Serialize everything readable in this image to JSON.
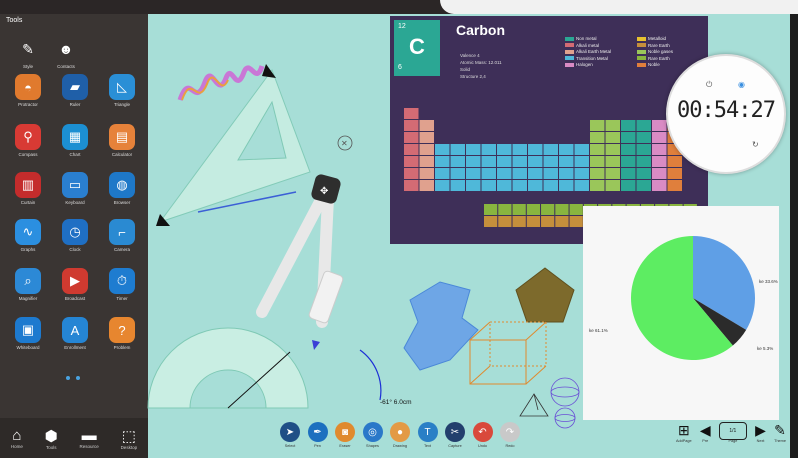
{
  "sidebar": {
    "title": "Tools",
    "top_items": [
      {
        "label": "Style",
        "icon": "paint-icon"
      },
      {
        "label": "Contacts",
        "icon": "contacts-icon"
      }
    ],
    "tools": [
      {
        "label": "Protractor",
        "icon": "protractor-icon",
        "color": "#e07a2e"
      },
      {
        "label": "Ruler",
        "icon": "ruler-icon",
        "color": "#1f5fa8"
      },
      {
        "label": "Triangle",
        "icon": "triangle-icon",
        "color": "#2a8fd6"
      },
      {
        "label": "Compass",
        "icon": "compass-icon",
        "color": "#d83a34"
      },
      {
        "label": "Chart",
        "icon": "chart-icon",
        "color": "#1c8fd2"
      },
      {
        "label": "Calculator",
        "icon": "calculator-icon",
        "color": "#e6823a"
      },
      {
        "label": "Curtain",
        "icon": "curtain-icon",
        "color": "#c42c2c"
      },
      {
        "label": "Keyboard",
        "icon": "keyboard-icon",
        "color": "#2a7fd0"
      },
      {
        "label": "Browser",
        "icon": "browser-icon",
        "color": "#1e78c8"
      },
      {
        "label": "Graphs",
        "icon": "graphs-icon",
        "color": "#2b8fe0"
      },
      {
        "label": "Clock",
        "icon": "clock-icon",
        "color": "#1f6fc4"
      },
      {
        "label": "Camera",
        "icon": "camera-icon",
        "color": "#2a8ad2"
      },
      {
        "label": "Magnifier",
        "icon": "magnifier-icon",
        "color": "#2c89d6"
      },
      {
        "label": "Broadcast",
        "icon": "broadcast-icon",
        "color": "#cf3a30"
      },
      {
        "label": "Timer",
        "icon": "timer-icon",
        "color": "#1e7cd0"
      },
      {
        "label": "Whiteboard",
        "icon": "monitor-icon",
        "color": "#1d7acf"
      },
      {
        "label": "Enrollment",
        "icon": "grade-icon",
        "color": "#2585d4"
      },
      {
        "label": "Problem",
        "icon": "question-icon",
        "color": "#e7862f"
      }
    ],
    "bottom": [
      {
        "label": "Home",
        "glyph": "⌂",
        "icon": "home-icon"
      },
      {
        "label": "Tools",
        "glyph": "⬢",
        "icon": "tools-icon"
      },
      {
        "label": "Resource",
        "glyph": "▬",
        "icon": "folder-icon"
      },
      {
        "label": "Desktop",
        "glyph": "⬚",
        "icon": "desktop-icon"
      }
    ]
  },
  "periodic_table": {
    "atomic_number": "12",
    "symbol": "C",
    "mass_number": "6",
    "name": "Carbon",
    "info_lines": [
      "Valence 4",
      "Atomic Mass: 12.011",
      "Solid",
      "Structure 2,4"
    ],
    "legend": [
      {
        "label": "Non metal",
        "color": "#2ba794"
      },
      {
        "label": "Alkali metal",
        "color": "#d36b74"
      },
      {
        "label": "Alkali Earth Metal",
        "color": "#e0a18e"
      },
      {
        "label": "Transition Metal",
        "color": "#4fb8d9"
      },
      {
        "label": "Halogen",
        "color": "#d98bc4"
      },
      {
        "label": "Metalloid",
        "color": "#e6c12f"
      },
      {
        "label": "Rare Earth",
        "color": "#c58f3c"
      },
      {
        "label": "Noble gases",
        "color": "#9ac65a"
      },
      {
        "label": "Rare Earth",
        "color": "#89b53f"
      },
      {
        "label": "Noble",
        "color": "#e07f3c"
      }
    ]
  },
  "clock": {
    "time": "00:54:27"
  },
  "measurement": "-61° 6.0cm",
  "pie": {
    "slices": [
      {
        "label": "ke 33.6%",
        "value": 33.6,
        "color": "#5f9fe6"
      },
      {
        "label": "ke 5.3%",
        "value": 5.3,
        "color": "#2b2b2b"
      },
      {
        "label": "ke 61.1%",
        "value": 61.1,
        "color": "#5ded62"
      }
    ]
  },
  "toolbar": [
    {
      "label": "Select",
      "icon": "select-icon",
      "color": "#1f4f86"
    },
    {
      "label": "Pen",
      "icon": "pen-icon",
      "color": "#1c6fbf"
    },
    {
      "label": "Eraser",
      "icon": "eraser-icon",
      "color": "#e08a2e"
    },
    {
      "label": "Shapes",
      "icon": "shapes-icon",
      "color": "#2a78c9"
    },
    {
      "label": "Drawing",
      "icon": "drawing-icon",
      "color": "#e39a45"
    },
    {
      "label": "Text",
      "icon": "text-icon",
      "color": "#2a7fc6"
    },
    {
      "label": "Capture",
      "icon": "capture-icon",
      "color": "#233f6d"
    },
    {
      "label": "Undo",
      "icon": "undo-icon",
      "color": "#d9493b"
    },
    {
      "label": "Redo",
      "icon": "redo-icon",
      "color": "#c9c9c9"
    }
  ],
  "page_controls": {
    "items": [
      {
        "label": "AddPage",
        "glyph": "⊞",
        "icon": "add-page-icon"
      },
      {
        "label": "Pre",
        "glyph": "◀",
        "icon": "prev-icon"
      },
      {
        "label": "Page",
        "glyph": "",
        "icon": "page-icon"
      },
      {
        "label": "Next",
        "glyph": "▶",
        "icon": "next-icon"
      },
      {
        "label": "Theme",
        "glyph": "✎",
        "icon": "theme-icon"
      }
    ],
    "page_number": "1/1"
  }
}
